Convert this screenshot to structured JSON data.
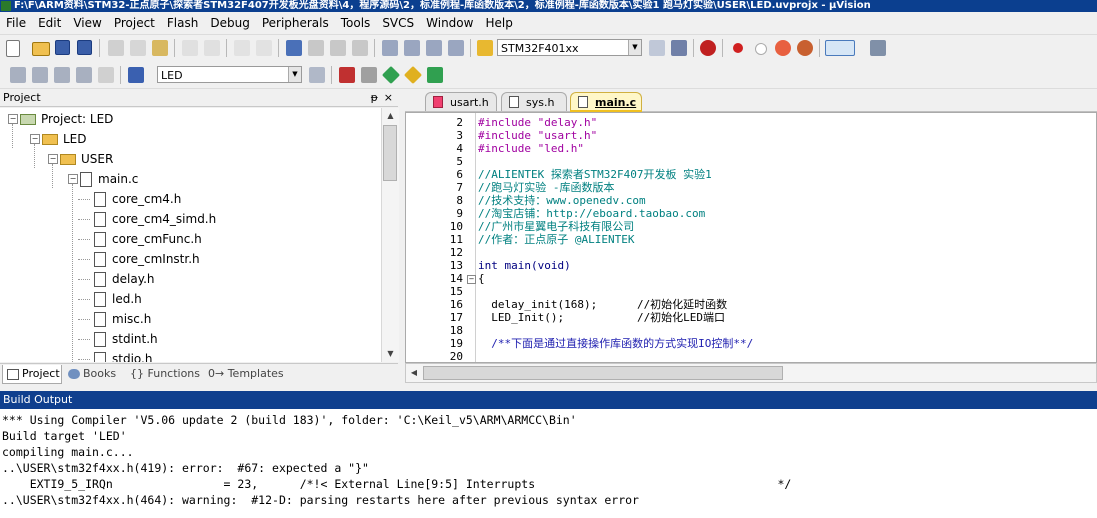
{
  "window": {
    "title": "F:\\F\\ARM资料\\STM32-正点原子\\探索者STM32F407开发板光盘资料\\4，程序源码\\2，标准例程-库函数版本\\2，标准例程-库函数版本\\实验1 跑马灯实验\\USER\\LED.uvprojx - µVision"
  },
  "menu": [
    "File",
    "Edit",
    "View",
    "Project",
    "Flash",
    "Debug",
    "Peripherals",
    "Tools",
    "SVCS",
    "Window",
    "Help"
  ],
  "toolbar1": {
    "device_combo": "STM32F401xx"
  },
  "toolbar2": {
    "target_combo": "LED"
  },
  "project_pane": {
    "title": "Project",
    "pin": "ᵽ",
    "close": "×",
    "tree": [
      {
        "label": "Project: LED",
        "level": 0,
        "kind": "project",
        "expander": "−"
      },
      {
        "label": "LED",
        "level": 1,
        "kind": "target",
        "expander": "−"
      },
      {
        "label": "USER",
        "level": 2,
        "kind": "folder",
        "expander": "−"
      },
      {
        "label": "main.c",
        "level": 3,
        "kind": "file",
        "expander": "−"
      },
      {
        "label": "core_cm4.h",
        "level": 4,
        "kind": "file"
      },
      {
        "label": "core_cm4_simd.h",
        "level": 4,
        "kind": "file"
      },
      {
        "label": "core_cmFunc.h",
        "level": 4,
        "kind": "file"
      },
      {
        "label": "core_cmInstr.h",
        "level": 4,
        "kind": "file"
      },
      {
        "label": "delay.h",
        "level": 4,
        "kind": "file"
      },
      {
        "label": "led.h",
        "level": 4,
        "kind": "file"
      },
      {
        "label": "misc.h",
        "level": 4,
        "kind": "file"
      },
      {
        "label": "stdint.h",
        "level": 4,
        "kind": "file"
      },
      {
        "label": "stdio.h",
        "level": 4,
        "kind": "file"
      }
    ],
    "tabs": [
      {
        "label": "Project",
        "active": true
      },
      {
        "label": "Books",
        "active": false
      },
      {
        "label": "{} Functions",
        "active": false
      },
      {
        "label": "0→ Templates",
        "active": false
      }
    ]
  },
  "editor_tabs": [
    {
      "label": "usart.h",
      "active": false
    },
    {
      "label": "sys.h",
      "active": false
    },
    {
      "label": "main.c",
      "active": true
    }
  ],
  "editor": {
    "lines": [
      {
        "n": "2",
        "text": "#include \"delay.h\"",
        "style": "pp"
      },
      {
        "n": "3",
        "text": "#include \"usart.h\"",
        "style": "pp"
      },
      {
        "n": "4",
        "text": "#include \"led.h\"",
        "style": "pp"
      },
      {
        "n": "5",
        "text": "",
        "style": ""
      },
      {
        "n": "6",
        "text": "//ALIENTEK 探索者STM32F407开发板 实验1",
        "style": "cm"
      },
      {
        "n": "7",
        "text": "//跑马灯实验 -库函数版本",
        "style": "cm"
      },
      {
        "n": "8",
        "text": "//技术支持：www.openedv.com",
        "style": "cm"
      },
      {
        "n": "9",
        "text": "//淘宝店铺：http://eboard.taobao.com",
        "style": "cm"
      },
      {
        "n": "10",
        "text": "//广州市星翼电子科技有限公司",
        "style": "cm"
      },
      {
        "n": "11",
        "text": "//作者：正点原子 @ALIENTEK",
        "style": "cm"
      },
      {
        "n": "12",
        "text": "",
        "style": ""
      },
      {
        "n": "13",
        "text": "int main(void)",
        "style": "fn"
      },
      {
        "n": "14",
        "text": "{",
        "style": ""
      },
      {
        "n": "15",
        "text": "",
        "style": ""
      },
      {
        "n": "16",
        "text": "  delay_init(168);      //初始化延时函数",
        "style": "call"
      },
      {
        "n": "17",
        "text": "  LED_Init();           //初始化LED端口",
        "style": "call"
      },
      {
        "n": "18",
        "text": "",
        "style": ""
      },
      {
        "n": "19",
        "text": "  /**下面是通过直接操作库函数的方式实现IO控制**/",
        "style": "cmb"
      },
      {
        "n": "20",
        "text": "",
        "style": ""
      }
    ]
  },
  "build_output": {
    "title": "Build Output",
    "lines": [
      "*** Using Compiler 'V5.06 update 2 (build 183)', folder: 'C:\\Keil_v5\\ARM\\ARMCC\\Bin'",
      "Build target 'LED'",
      "compiling main.c...",
      "..\\USER\\stm32f4xx.h(419): error:  #67: expected a \"}\"",
      "    EXTI9_5_IRQn                = 23,      /*!< External Line[9:5] Interrupts                                   */",
      "..\\USER\\stm32f4xx.h(464): warning:  #12-D: parsing restarts here after previous syntax error"
    ]
  }
}
